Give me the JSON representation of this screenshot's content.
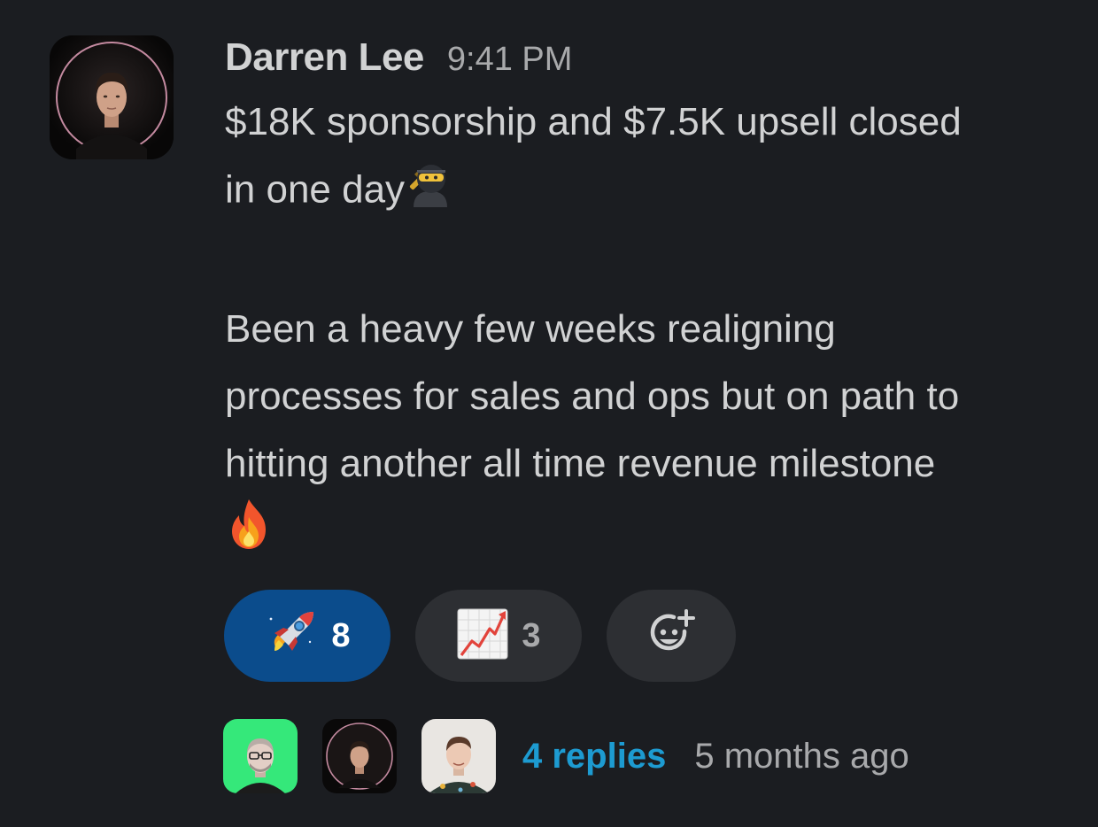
{
  "message": {
    "author": "Darren Lee",
    "time": "9:41 PM",
    "line1": "$18K sponsorship and $7.5K upsell closed",
    "line2": "in one day",
    "para2_line1": "Been a heavy few weeks realigning",
    "para2_line2": "processes for sales and ops but on path to",
    "para2_line3": "hitting another all time revenue milestone",
    "emoji_inline_1": "ninja-emoji",
    "emoji_inline_2": "fire-emoji"
  },
  "reactions": [
    {
      "emoji": "rocket-emoji",
      "count": "8",
      "active": true
    },
    {
      "emoji": "chart-increasing-emoji",
      "count": "3",
      "active": false
    },
    {
      "emoji": "add-reaction-icon"
    }
  ],
  "thread": {
    "replies_label": "4 replies",
    "last_reply": "5 months ago"
  },
  "colors": {
    "background": "#1b1d21",
    "text": "#d1d2d3",
    "muted": "#a8a9ab",
    "link": "#1d9bd1",
    "reaction_active": "#0b4c8c",
    "reaction_bg": "#2d2f33"
  }
}
